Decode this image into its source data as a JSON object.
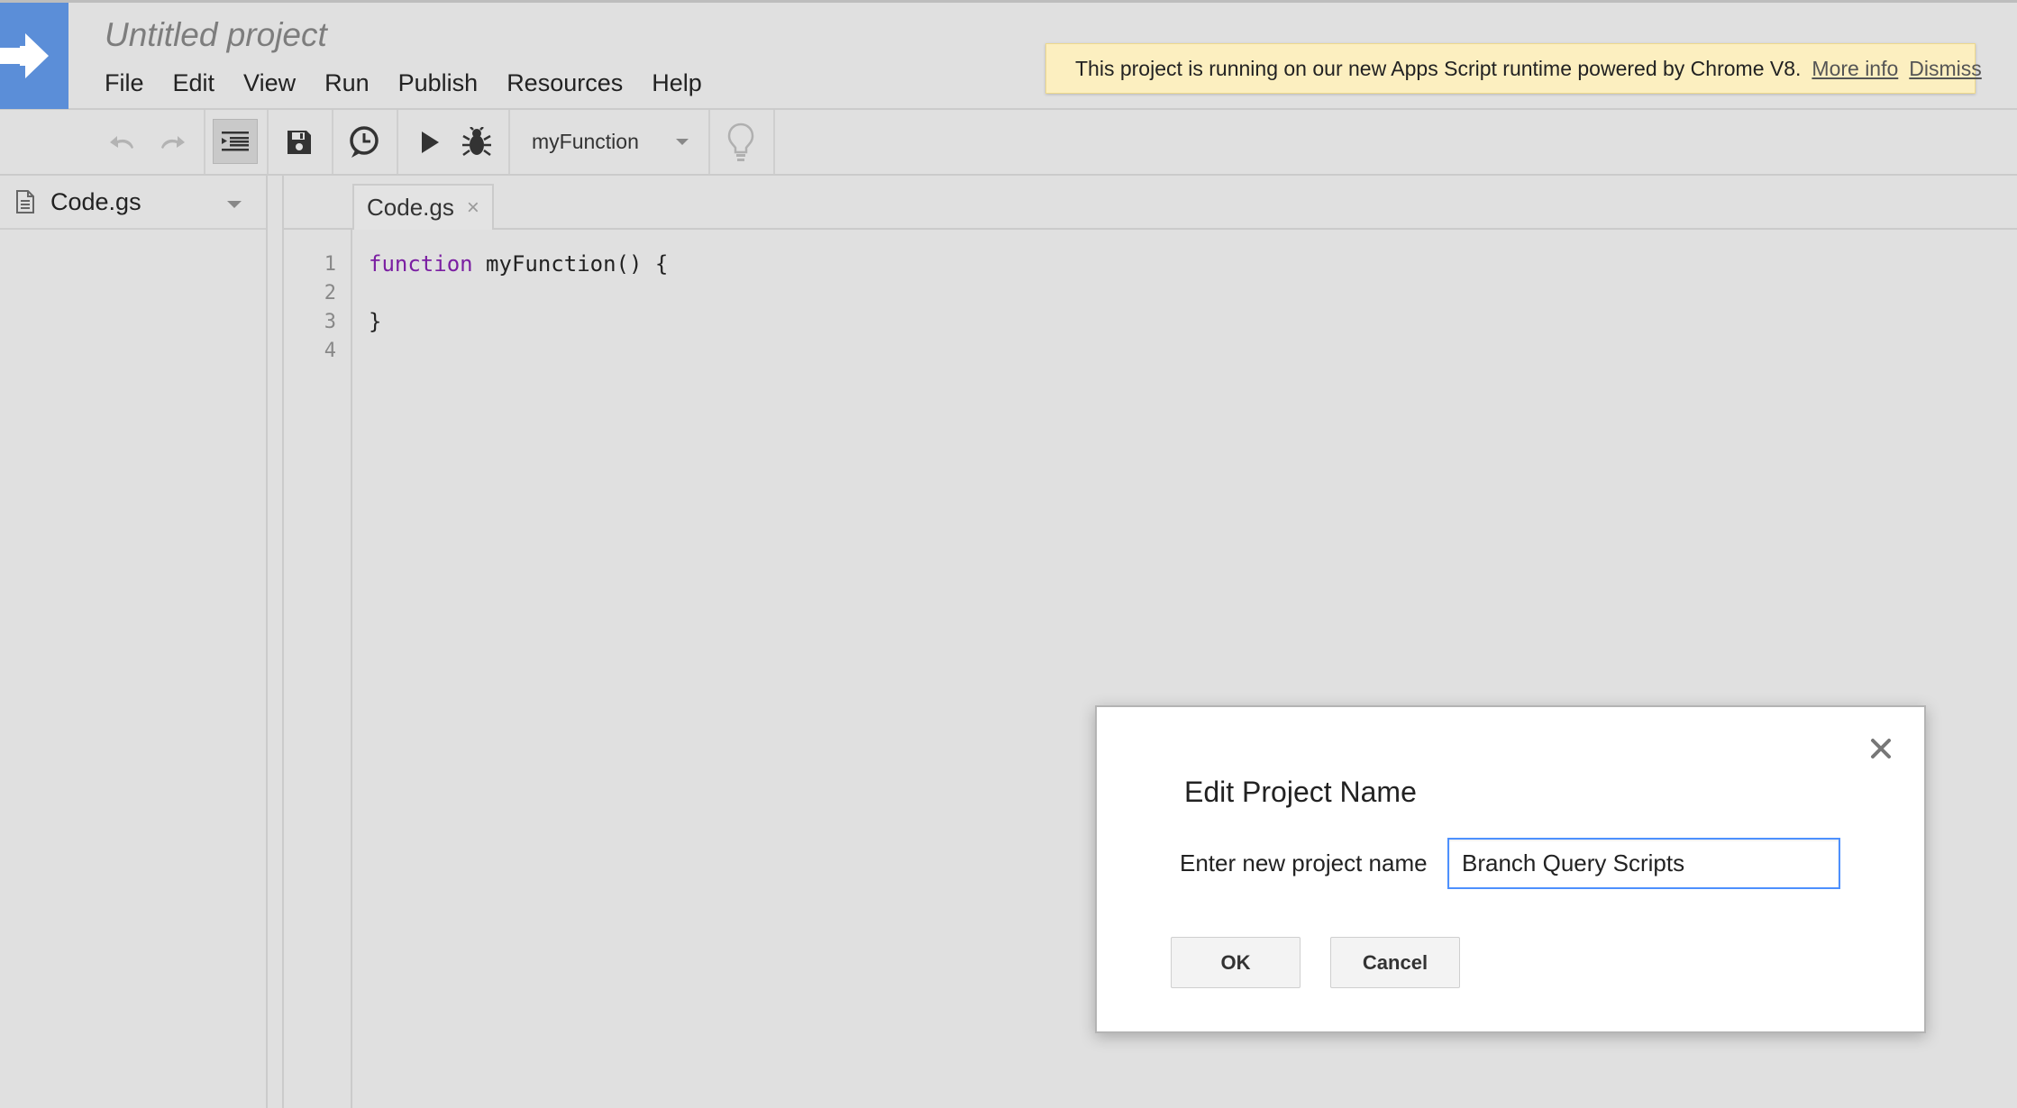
{
  "header": {
    "project_title": "Untitled project",
    "menu": [
      "File",
      "Edit",
      "View",
      "Run",
      "Publish",
      "Resources",
      "Help"
    ]
  },
  "banner": {
    "message": "This project is running on our new Apps Script runtime powered by Chrome V8.",
    "more_info": "More info",
    "dismiss": "Dismiss"
  },
  "toolbar": {
    "selected_function": "myFunction",
    "icons": [
      "undo-icon",
      "redo-icon",
      "indent-icon",
      "save-icon",
      "triggers-clock-icon",
      "run-icon",
      "debug-bug-icon",
      "dropdown-caret-icon",
      "lightbulb-icon"
    ]
  },
  "sidebar": {
    "files": [
      {
        "name": "Code.gs"
      }
    ]
  },
  "editor": {
    "tab": "Code.gs",
    "tab_close": "×",
    "line_numbers": [
      "1",
      "2",
      "3",
      "4"
    ],
    "code": {
      "line1_keyword": "function",
      "line1_rest": " myFunction() {",
      "line3": "}"
    }
  },
  "dialog": {
    "title": "Edit Project Name",
    "label": "Enter new project name",
    "input_value": "Branch Query Scripts",
    "ok": "OK",
    "cancel": "Cancel"
  },
  "colors": {
    "logo_blue": "#5b8ed8",
    "banner_bg": "#fcefc0",
    "keyword": "#7b1fa2",
    "input_focus": "#4d90fe"
  }
}
